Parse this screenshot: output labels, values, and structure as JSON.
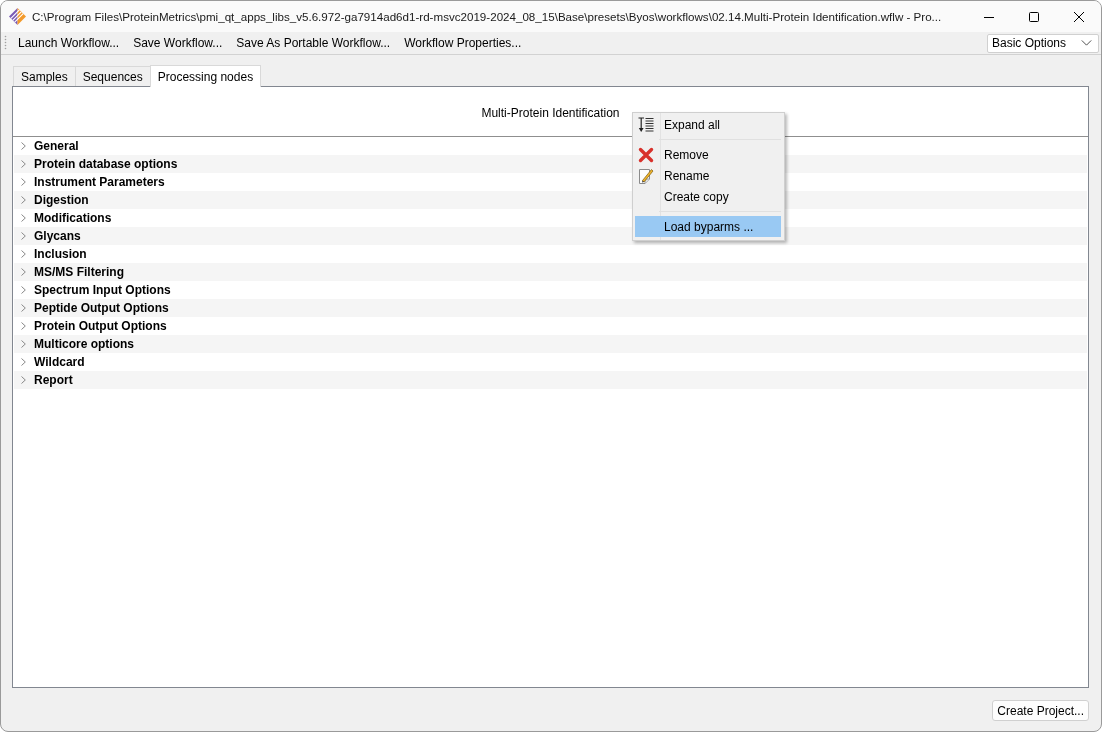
{
  "window": {
    "title": "C:\\Program Files\\ProteinMetrics\\pmi_qt_apps_libs_v5.6.972-ga7914ad6d1-rd-msvc2019-2024_08_15\\Base\\presets\\Byos\\workflows\\02.14.Multi-Protein Identification.wflw - Pro..."
  },
  "toolbar": {
    "actions": [
      "Launch Workflow...",
      "Save Workflow...",
      "Save As Portable Workflow...",
      "Workflow Properties..."
    ],
    "options_dropdown": {
      "value": "Basic Options"
    }
  },
  "tabs": [
    {
      "label": "Samples",
      "selected": false
    },
    {
      "label": "Sequences",
      "selected": false
    },
    {
      "label": "Processing nodes",
      "selected": true
    }
  ],
  "workflow_panel": {
    "title": "Multi-Protein Identification",
    "sections": [
      {
        "label": "General",
        "expanded": false
      },
      {
        "label": "Protein database options",
        "expanded": false
      },
      {
        "label": "Instrument Parameters",
        "expanded": false
      },
      {
        "label": "Digestion",
        "expanded": false
      },
      {
        "label": "Modifications",
        "expanded": false
      },
      {
        "label": "Glycans",
        "expanded": false
      },
      {
        "label": "Inclusion",
        "expanded": false
      },
      {
        "label": "MS/MS Filtering",
        "expanded": false
      },
      {
        "label": "Spectrum Input Options",
        "expanded": false
      },
      {
        "label": "Peptide Output Options",
        "expanded": false
      },
      {
        "label": "Protein Output Options",
        "expanded": false
      },
      {
        "label": "Multicore options",
        "expanded": false
      },
      {
        "label": "Wildcard",
        "expanded": false
      },
      {
        "label": "Report",
        "expanded": false
      }
    ]
  },
  "context_menu": {
    "groups": [
      {
        "items": [
          {
            "kind": "expand",
            "label": "Expand all",
            "selected": false
          }
        ]
      },
      {
        "items": [
          {
            "kind": "delete",
            "label": "Remove",
            "selected": false
          },
          {
            "kind": "edit",
            "label": "Rename",
            "selected": false
          },
          {
            "kind": "plain",
            "label": "Create copy",
            "selected": false
          }
        ]
      },
      {
        "items": [
          {
            "kind": "plain",
            "label": "Load byparms ...",
            "selected": true
          }
        ]
      }
    ]
  },
  "footer": {
    "buttons": [
      "Create Project..."
    ]
  }
}
